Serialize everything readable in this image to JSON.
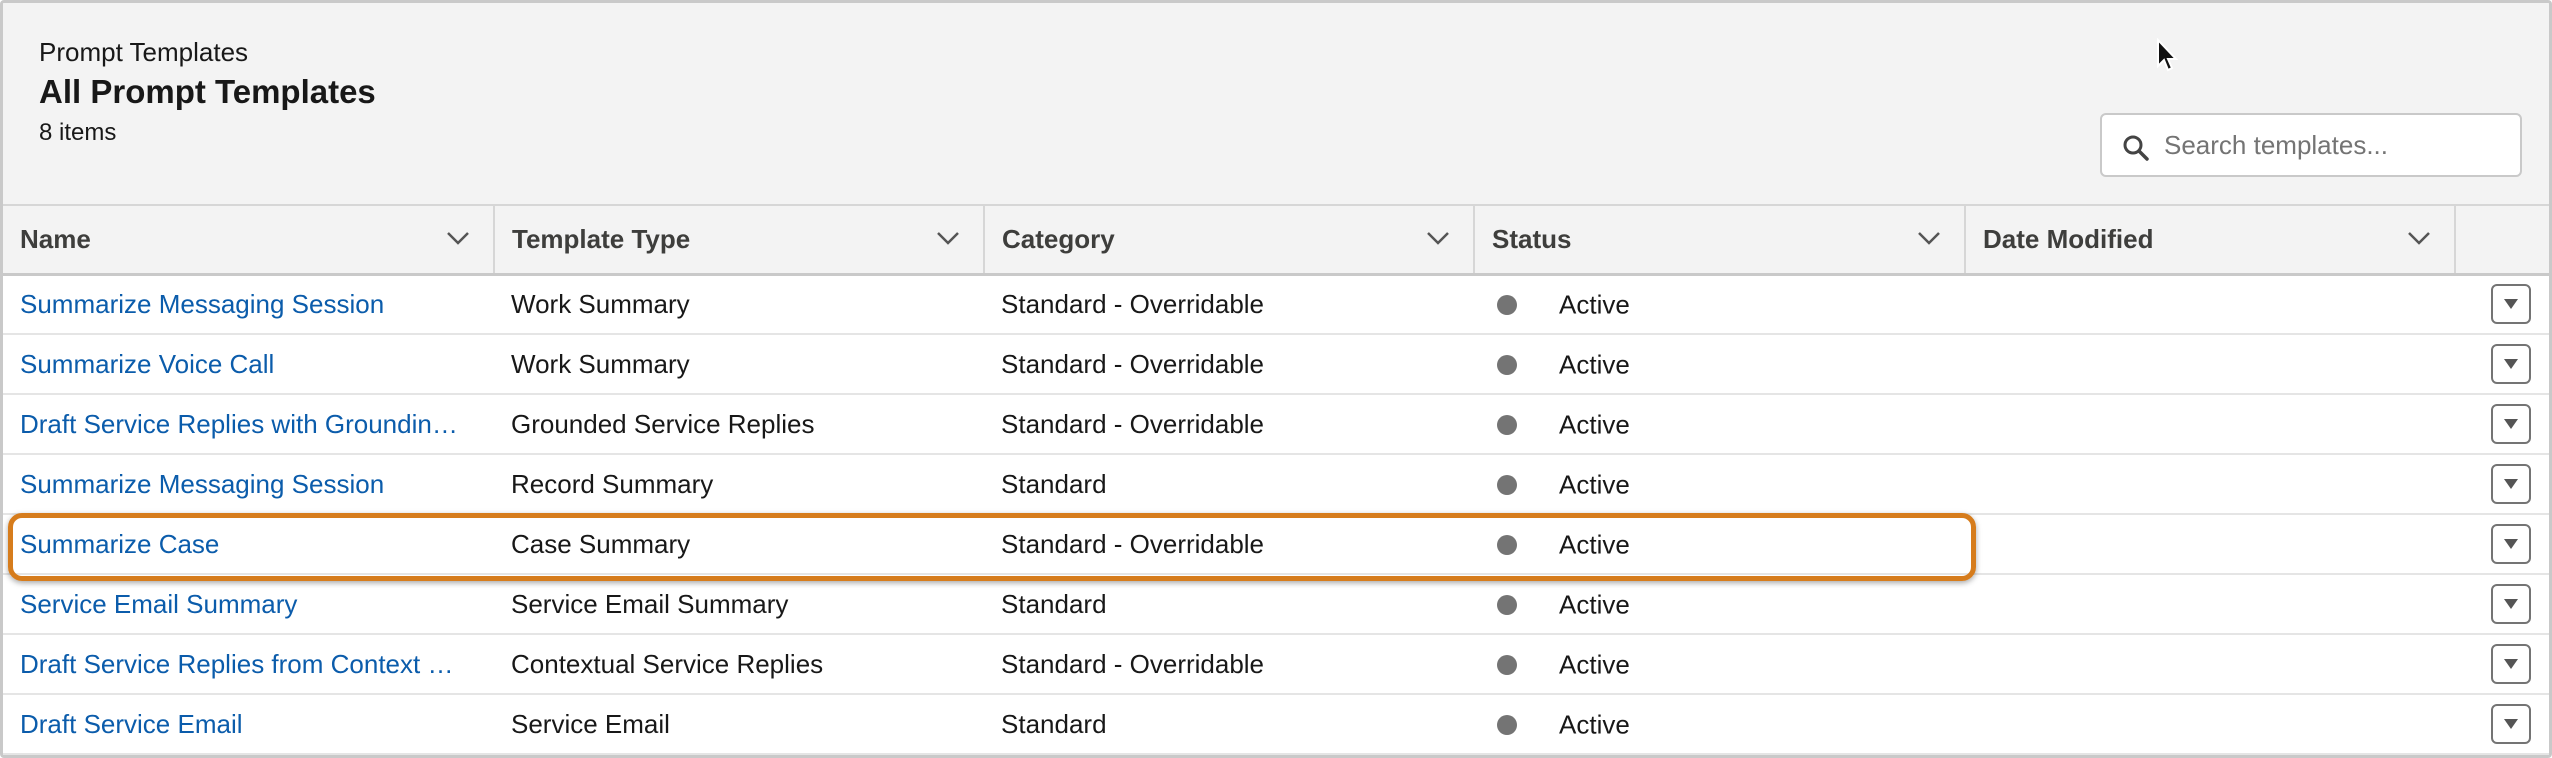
{
  "header": {
    "pretitle": "Prompt Templates",
    "title": "All Prompt Templates",
    "count": "8 items"
  },
  "search": {
    "placeholder": "Search templates...",
    "value": ""
  },
  "columns": {
    "name": "Name",
    "type": "Template Type",
    "category": "Category",
    "status": "Status",
    "modified": "Date Modified"
  },
  "rows": [
    {
      "name": "Summarize Messaging Session",
      "type": "Work Summary",
      "category": "Standard - Overridable",
      "status": "Active",
      "modified": ""
    },
    {
      "name": "Summarize Voice Call",
      "type": "Work Summary",
      "category": "Standard - Overridable",
      "status": "Active",
      "modified": ""
    },
    {
      "name": "Draft Service Replies with Groundin…",
      "type": "Grounded Service Replies",
      "category": "Standard - Overridable",
      "status": "Active",
      "modified": ""
    },
    {
      "name": "Summarize Messaging Session",
      "type": "Record Summary",
      "category": "Standard",
      "status": "Active",
      "modified": ""
    },
    {
      "name": "Summarize Case",
      "type": "Case Summary",
      "category": "Standard - Overridable",
      "status": "Active",
      "modified": ""
    },
    {
      "name": "Service Email Summary",
      "type": "Service Email Summary",
      "category": "Standard",
      "status": "Active",
      "modified": ""
    },
    {
      "name": "Draft Service Replies from Context …",
      "type": "Contextual Service Replies",
      "category": "Standard - Overridable",
      "status": "Active",
      "modified": ""
    },
    {
      "name": "Draft Service Email",
      "type": "Service Email",
      "category": "Standard",
      "status": "Active",
      "modified": ""
    }
  ],
  "highlighted_row": "Summarize Case",
  "colors": {
    "link": "#0b5cab",
    "highlight": "#d67c1c",
    "status_dot": "#747474"
  },
  "icons": {
    "search": "search-icon",
    "column_menu": "chevron-down-icon",
    "row_action": "caret-down-icon",
    "cursor": "mouse-pointer-icon"
  }
}
